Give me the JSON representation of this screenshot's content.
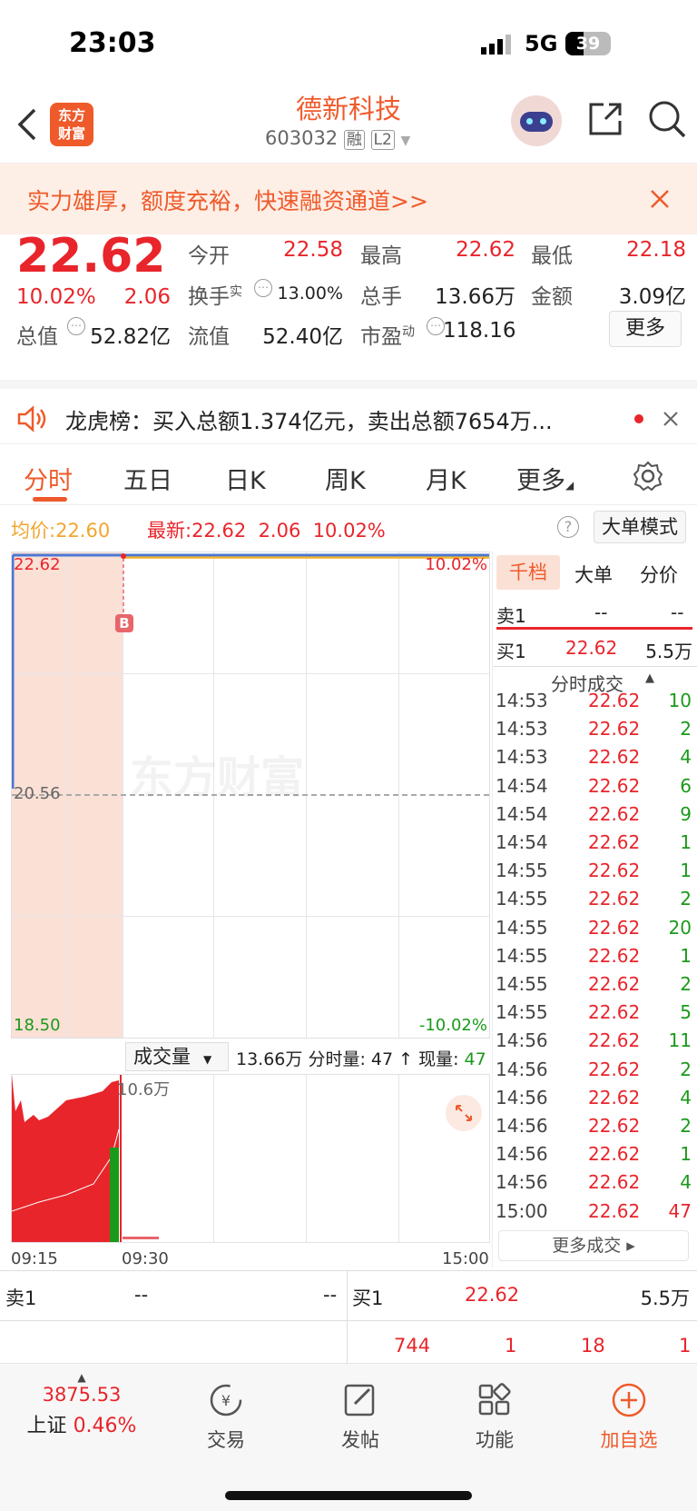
{
  "status_bar": {
    "time": "23:03",
    "network": "5G",
    "battery": "39"
  },
  "header": {
    "logo_text_1": "东方",
    "logo_text_2": "财富",
    "stock_name": "德新科技",
    "stock_code": "603032",
    "badge_rong": "融",
    "badge_l2": "L2"
  },
  "banner": {
    "text": "实力雄厚，额度充裕，快速融资通道>>"
  },
  "quote": {
    "price": "22.62",
    "change_pct": "10.02%",
    "change": "2.06",
    "open_label": "今开",
    "open": "22.58",
    "high_label": "最高",
    "high": "22.62",
    "low_label": "最低",
    "low": "22.18",
    "turnover_label": "换手",
    "turnover_sup": "实",
    "turnover": "13.00%",
    "volume_label": "总手",
    "volume": "13.66万",
    "amount_label": "金额",
    "amount": "3.09亿",
    "mktcap_label": "总值",
    "mktcap": "52.82亿",
    "float_label": "流值",
    "float": "52.40亿",
    "pe_label": "市盈",
    "pe_sup": "动",
    "pe": "118.16",
    "more_button": "更多"
  },
  "notice": {
    "text": "龙虎榜：买入总额1.374亿元，卖出总额7654万..."
  },
  "tabs": [
    "分时",
    "五日",
    "日K",
    "周K",
    "月K",
    "更多"
  ],
  "chart_header": {
    "avg_label": "均价:",
    "avg": "22.60",
    "last_label": "最新:",
    "last": "22.62",
    "chg": "2.06",
    "pct": "10.02%",
    "mode_button": "大单模式"
  },
  "chart_data": {
    "type": "line",
    "ylim": [
      18.5,
      22.62
    ],
    "y_left_ticks": [
      "22.62",
      "20.56",
      "18.50"
    ],
    "y_right_ticks": [
      "10.02%",
      "-10.02%"
    ],
    "x_ticks": [
      "09:15",
      "09:30",
      "15:00"
    ],
    "reference_price": 20.56,
    "series": [
      {
        "name": "最新",
        "color": "#4a78d4",
        "values": [
          22.62,
          22.62,
          22.62,
          22.62,
          22.62
        ]
      },
      {
        "name": "均价",
        "color": "#f2b52e",
        "values": [
          22.6,
          22.6,
          22.6,
          22.6,
          22.6
        ]
      }
    ],
    "marker": "B",
    "watermark": "东方财富"
  },
  "volume_header": {
    "selector": "成交量",
    "total": "13.66万",
    "minute_label": "分时量:",
    "minute": "47",
    "now_label": "现量:",
    "now": "47",
    "max_tick": "10.6万"
  },
  "side_tabs": [
    "千档",
    "大单",
    "分价"
  ],
  "order_book_small": {
    "sell1_label": "卖1",
    "sell1_price": "--",
    "sell1_vol": "--",
    "buy1_label": "买1",
    "buy1_price": "22.62",
    "buy1_vol": "5.5万"
  },
  "trades_title": "分时成交",
  "trades": [
    {
      "t": "14:53",
      "p": "22.62",
      "v": "10",
      "c": "green"
    },
    {
      "t": "14:53",
      "p": "22.62",
      "v": "2",
      "c": "green"
    },
    {
      "t": "14:53",
      "p": "22.62",
      "v": "4",
      "c": "green"
    },
    {
      "t": "14:54",
      "p": "22.62",
      "v": "6",
      "c": "green"
    },
    {
      "t": "14:54",
      "p": "22.62",
      "v": "9",
      "c": "green"
    },
    {
      "t": "14:54",
      "p": "22.62",
      "v": "1",
      "c": "green"
    },
    {
      "t": "14:55",
      "p": "22.62",
      "v": "1",
      "c": "green"
    },
    {
      "t": "14:55",
      "p": "22.62",
      "v": "2",
      "c": "green"
    },
    {
      "t": "14:55",
      "p": "22.62",
      "v": "20",
      "c": "green"
    },
    {
      "t": "14:55",
      "p": "22.62",
      "v": "1",
      "c": "green"
    },
    {
      "t": "14:55",
      "p": "22.62",
      "v": "2",
      "c": "green"
    },
    {
      "t": "14:55",
      "p": "22.62",
      "v": "5",
      "c": "green"
    },
    {
      "t": "14:56",
      "p": "22.62",
      "v": "11",
      "c": "green"
    },
    {
      "t": "14:56",
      "p": "22.62",
      "v": "2",
      "c": "green"
    },
    {
      "t": "14:56",
      "p": "22.62",
      "v": "4",
      "c": "green"
    },
    {
      "t": "14:56",
      "p": "22.62",
      "v": "2",
      "c": "green"
    },
    {
      "t": "14:56",
      "p": "22.62",
      "v": "1",
      "c": "green"
    },
    {
      "t": "14:56",
      "p": "22.62",
      "v": "4",
      "c": "green"
    },
    {
      "t": "15:00",
      "p": "22.62",
      "v": "47",
      "c": "red"
    }
  ],
  "more_trades": "更多成交",
  "order_book": {
    "sell1_label": "卖1",
    "sell1_price": "--",
    "sell1_vol": "--",
    "buy1_label": "买1",
    "buy1_price": "22.62",
    "buy1_vol": "5.5万",
    "row2": [
      "744",
      "1",
      "18",
      "1"
    ]
  },
  "bottom_nav": {
    "index_value": "3875.53",
    "index_name": "上证",
    "index_pct": "0.46%",
    "trade": "交易",
    "post": "发帖",
    "func": "功能",
    "watch": "加自选"
  }
}
